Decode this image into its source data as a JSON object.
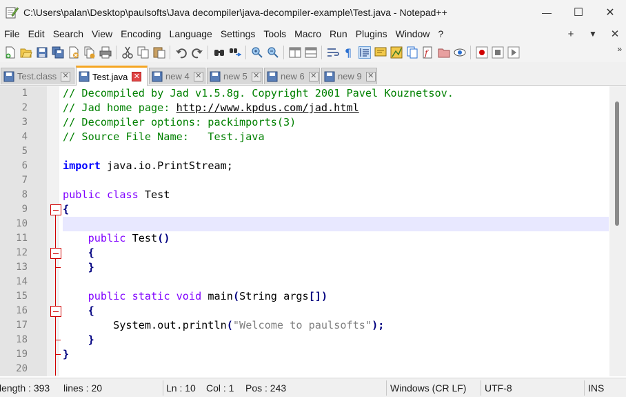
{
  "window": {
    "title": "C:\\Users\\palan\\Desktop\\paulsofts\\Java decompiler\\java-decompiler-example\\Test.java - Notepad++",
    "minimize": "—",
    "maximize": "☐",
    "close": "✕"
  },
  "menu": {
    "items": [
      "File",
      "Edit",
      "Search",
      "View",
      "Encoding",
      "Language",
      "Settings",
      "Tools",
      "Macro",
      "Run",
      "Plugins",
      "Window",
      "?"
    ],
    "right": [
      "+",
      "▼",
      "✕"
    ]
  },
  "toolbar": {
    "more": "»"
  },
  "tabs": [
    {
      "label": "Test.class",
      "active": false,
      "close": "✕"
    },
    {
      "label": "Test.java",
      "active": true,
      "close": "✕"
    },
    {
      "label": "new 4",
      "active": false,
      "close": "✕"
    },
    {
      "label": "new 5",
      "active": false,
      "close": "✕"
    },
    {
      "label": "new 6",
      "active": false,
      "close": "✕"
    },
    {
      "label": "new 9",
      "active": false,
      "close": "✕"
    }
  ],
  "editor": {
    "current_line": 10,
    "lines": [
      {
        "n": "1",
        "parts": [
          {
            "t": "cm",
            "v": "// Decompiled by Jad v1.5.8g. Copyright 2001 Pavel Kouznetsov."
          }
        ]
      },
      {
        "n": "2",
        "parts": [
          {
            "t": "cm",
            "v": "// Jad home page: "
          },
          {
            "t": "url",
            "v": "http://www.kpdus.com/jad.html"
          }
        ]
      },
      {
        "n": "3",
        "parts": [
          {
            "t": "cm",
            "v": "// Decompiler options: packimports(3)"
          }
        ]
      },
      {
        "n": "4",
        "parts": [
          {
            "t": "cm",
            "v": "// Source File Name:   Test.java"
          }
        ]
      },
      {
        "n": "5",
        "parts": []
      },
      {
        "n": "6",
        "parts": [
          {
            "t": "kw",
            "v": "import"
          },
          {
            "t": "pl",
            "v": " java.io.PrintStream;"
          }
        ]
      },
      {
        "n": "7",
        "parts": []
      },
      {
        "n": "8",
        "parts": [
          {
            "t": "kw2",
            "v": "public"
          },
          {
            "t": "pl",
            "v": " "
          },
          {
            "t": "kw2",
            "v": "class"
          },
          {
            "t": "pl",
            "v": " Test"
          }
        ]
      },
      {
        "n": "9",
        "parts": [
          {
            "t": "op",
            "v": "{"
          }
        ]
      },
      {
        "n": "10",
        "parts": []
      },
      {
        "n": "11",
        "parts": [
          {
            "t": "pl",
            "v": "    "
          },
          {
            "t": "kw2",
            "v": "public"
          },
          {
            "t": "pl",
            "v": " Test"
          },
          {
            "t": "op",
            "v": "()"
          }
        ]
      },
      {
        "n": "12",
        "parts": [
          {
            "t": "pl",
            "v": "    "
          },
          {
            "t": "op",
            "v": "{"
          }
        ]
      },
      {
        "n": "13",
        "parts": [
          {
            "t": "pl",
            "v": "    "
          },
          {
            "t": "op",
            "v": "}"
          }
        ]
      },
      {
        "n": "14",
        "parts": []
      },
      {
        "n": "15",
        "parts": [
          {
            "t": "pl",
            "v": "    "
          },
          {
            "t": "kw2",
            "v": "public"
          },
          {
            "t": "pl",
            "v": " "
          },
          {
            "t": "kw2",
            "v": "static"
          },
          {
            "t": "pl",
            "v": " "
          },
          {
            "t": "kw2",
            "v": "void"
          },
          {
            "t": "pl",
            "v": " main"
          },
          {
            "t": "op",
            "v": "("
          },
          {
            "t": "pl",
            "v": "String args"
          },
          {
            "t": "op",
            "v": "[])"
          }
        ]
      },
      {
        "n": "16",
        "parts": [
          {
            "t": "pl",
            "v": "    "
          },
          {
            "t": "op",
            "v": "{"
          }
        ]
      },
      {
        "n": "17",
        "parts": [
          {
            "t": "pl",
            "v": "        System.out.println"
          },
          {
            "t": "op",
            "v": "("
          },
          {
            "t": "str",
            "v": "\"Welcome to paulsofts\""
          },
          {
            "t": "op",
            "v": ");"
          }
        ]
      },
      {
        "n": "18",
        "parts": [
          {
            "t": "pl",
            "v": "    "
          },
          {
            "t": "op",
            "v": "}"
          }
        ]
      },
      {
        "n": "19",
        "parts": [
          {
            "t": "op",
            "v": "}"
          }
        ]
      },
      {
        "n": "20",
        "parts": []
      }
    ]
  },
  "status": {
    "length": "length : 393",
    "lines": "lines : 20",
    "ln": "Ln : 10",
    "col": "Col : 1",
    "pos": "Pos : 243",
    "eol": "Windows (CR LF)",
    "encoding": "UTF-8",
    "mode": "INS"
  },
  "colors": {
    "comment": "#008000",
    "keyword_instruction": "#0000ff",
    "keyword_type": "#8000ff",
    "operator": "#000080",
    "string": "#808080",
    "current_line_bg": "#e8e8ff",
    "fold_marker": "#d00000",
    "active_tab_accent": "#f5a623"
  },
  "icons": {
    "toolbar": [
      "new-file-icon",
      "open-file-icon",
      "save-icon",
      "save-all-icon",
      "close-icon",
      "close-all-icon",
      "print-icon",
      "cut-icon",
      "copy-icon",
      "paste-icon",
      "undo-icon",
      "redo-icon",
      "find-icon",
      "replace-icon",
      "zoom-in-icon",
      "zoom-out-icon",
      "sync-vertical-icon",
      "sync-horizontal-icon",
      "word-wrap-icon",
      "show-all-chars-icon",
      "indent-guide-icon",
      "udl-icon",
      "doc-map-icon",
      "doc-list-icon",
      "function-list-icon",
      "folder-workspace-icon",
      "monitor-icon",
      "record-macro-icon",
      "stop-macro-icon",
      "play-macro-icon"
    ]
  }
}
